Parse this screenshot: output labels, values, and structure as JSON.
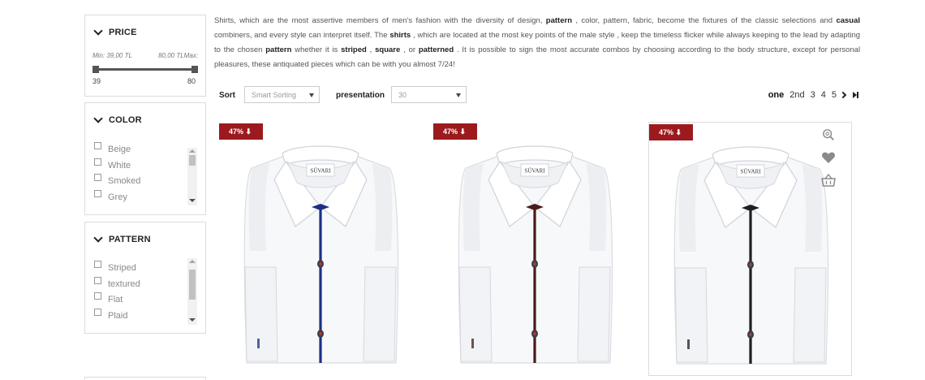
{
  "filters": {
    "price": {
      "title": "PRICE",
      "min_label": "Min: 39,00 TL",
      "max_label": "80,00 TLMax:",
      "min_value": "39",
      "max_value": "80"
    },
    "color": {
      "title": "COLOR",
      "options": [
        "Beige",
        "White",
        "Smoked",
        "Grey"
      ]
    },
    "pattern": {
      "title": "PATTERN",
      "options": [
        "Striped",
        "textured",
        "Flat",
        "Plaid"
      ]
    }
  },
  "description": {
    "t1": "Shirts, which are the most assertive members of men's fashion with the diversity of design,",
    "b1": "pattern",
    "t2": ", color, pattern, fabric,  become the fixtures of the classic selections and",
    "b2": "casual",
    "t3": "combiners, and every style can interpret itself. The",
    "b3": "shirts",
    "t4": ", which are located at the most key points of the male style  ,  keep the timeless flicker while always keeping to the lead by adapting to the chosen",
    "b4": "pattern",
    "t5": "whether it is",
    "b5": "striped",
    "t6": ",",
    "b6": "square",
    "t7": ", or",
    "b7": "patterned",
    "t8": ". It is possible to sign the most accurate combos by choosing according to the body structure, except for personal pleasures, these antiquated pieces which can be with you almost 7/24!"
  },
  "toolbar": {
    "sort_label": "Sort",
    "sort_value": "Smart Sorting",
    "presentation_label": "presentation",
    "presentation_value": "30",
    "pages": [
      "one",
      "2nd",
      "3",
      "4",
      "5"
    ],
    "current_page": "one"
  },
  "products": [
    {
      "badge": "47% ⬇",
      "placket_color": "#1d2f86",
      "brand": "SÜVARI"
    },
    {
      "badge": "47% ⬇",
      "placket_color": "#4a1b18",
      "brand": "SÜVARI"
    },
    {
      "badge": "47% ⬇",
      "placket_color": "#1f1f22",
      "brand": "SÜVARI"
    }
  ],
  "card_actions": [
    "zoom-icon",
    "heart-icon",
    "basket-icon"
  ],
  "colors": {
    "badge_bg": "#9c1a1e",
    "border": "#dcdcdc"
  }
}
